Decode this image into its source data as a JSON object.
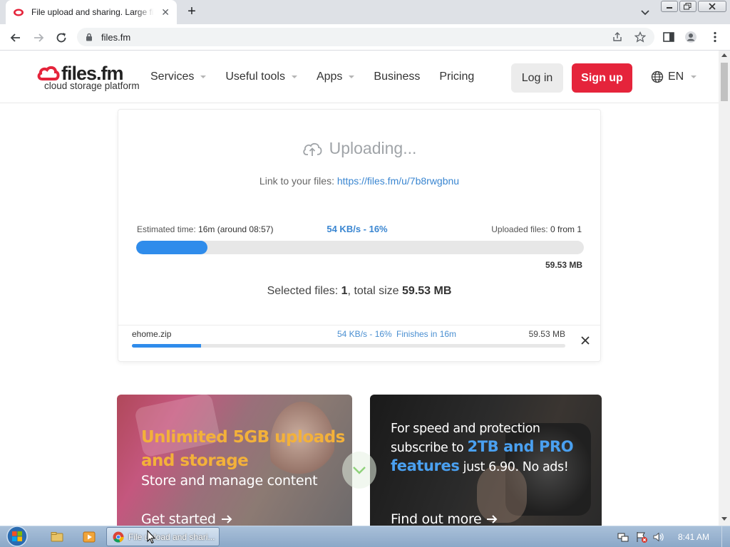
{
  "browser": {
    "tab_title": "File upload and sharing. Large files",
    "url": "files.fm"
  },
  "site": {
    "logo_name": "files.fm",
    "logo_tagline": "cloud storage platform",
    "nav": [
      {
        "label": "Services",
        "has_dropdown": true
      },
      {
        "label": "Useful tools",
        "has_dropdown": true
      },
      {
        "label": "Apps",
        "has_dropdown": true
      },
      {
        "label": "Business",
        "has_dropdown": false
      },
      {
        "label": "Pricing",
        "has_dropdown": false
      }
    ],
    "login_label": "Log in",
    "signup_label": "Sign up",
    "language": "EN",
    "brand_color": "#e5243b",
    "accent_color": "#2f8ceb"
  },
  "upload": {
    "status": "Uploading...",
    "link_prefix": "Link to your files:",
    "link_url": "https://files.fm/u/7b8rwgbnu",
    "estimated_label": "Estimated time:",
    "estimated_value": "16m (around 08:57)",
    "speed_progress": "54 KB/s - 16%",
    "uploaded_label": "Uploaded files:",
    "uploaded_value": "0 from 1",
    "progress_percent": 16,
    "total_size": "59.53 MB",
    "selected_prefix": "Selected files:",
    "selected_count": "1",
    "selected_mid": ", total size",
    "selected_size": "59.53 MB",
    "file": {
      "name": "ehome.zip",
      "speed": "54 KB/s - 16%",
      "finishes": "Finishes in 16m",
      "size": "59.53 MB",
      "progress_percent": 16
    }
  },
  "promo_left": {
    "heading_line1": "Unlimited 5GB uploads",
    "heading_line2": "and storage",
    "subtitle": "Store and manage content",
    "cta": "Get started"
  },
  "promo_right": {
    "line1": "For speed and protection",
    "line2_prefix": "subscribe to",
    "line2_highlight": "2TB and PRO",
    "line3_highlight": "features",
    "line3_suffix": "just 6.90. No ads!",
    "cta": "Find out more"
  },
  "taskbar": {
    "task_label": "File upload and shari...",
    "clock": "8:41 AM"
  }
}
